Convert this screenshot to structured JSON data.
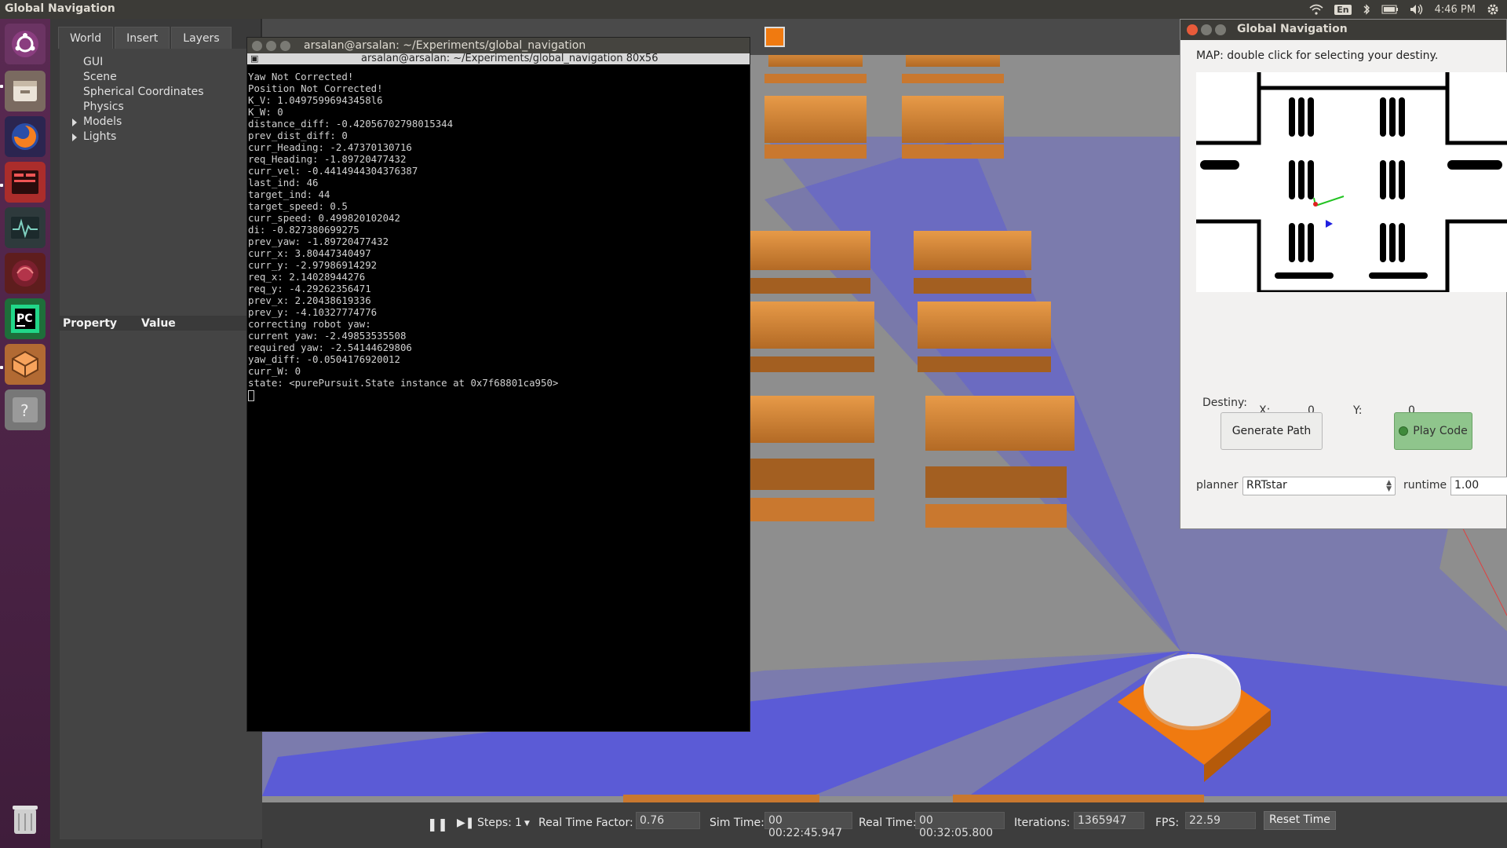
{
  "topbar": {
    "title": "Global Navigation",
    "lang": "En",
    "time": "4:46 PM"
  },
  "gazebo": {
    "tabs": [
      "World",
      "Insert",
      "Layers"
    ],
    "tree": [
      {
        "label": "GUI",
        "expandable": false
      },
      {
        "label": "Scene",
        "expandable": false
      },
      {
        "label": "Spherical Coordinates",
        "expandable": false
      },
      {
        "label": "Physics",
        "expandable": false
      },
      {
        "label": "Models",
        "expandable": true
      },
      {
        "label": "Lights",
        "expandable": true
      }
    ],
    "property_header": {
      "property": "Property",
      "value": "Value"
    },
    "bottom": {
      "steps_label": "Steps:",
      "steps_value": "1",
      "rtf_label": "Real Time Factor:",
      "rtf_value": "0.76",
      "sim_time_label": "Sim Time:",
      "sim_time_value": "00 00:22:45.947",
      "real_time_label": "Real Time:",
      "real_time_value": "00 00:32:05.800",
      "iterations_label": "Iterations:",
      "iterations_value": "1365947",
      "fps_label": "FPS:",
      "fps_value": "22.59",
      "reset_label": "Reset Time"
    }
  },
  "terminal": {
    "title": "arsalan@arsalan: ~/Experiments/global_navigation",
    "subtitle": "arsalan@arsalan: ~/Experiments/global_navigation 80x56",
    "lines": [
      "Yaw Not Corrected!",
      "Position Not Corrected!",
      "K_V: 1.04975996943458l6",
      "K_W: 0",
      "distance_diff: -0.42056702798015344",
      "prev_dist_diff: 0",
      "curr_Heading: -2.47370130716",
      "req_Heading: -1.89720477432",
      "curr_vel: -0.4414944304376387",
      "last_ind: 46",
      "target_ind: 44",
      "target_speed: 0.5",
      "curr_speed: 0.499820102042",
      "di: -0.827380699275",
      "prev_yaw: -1.89720477432",
      "curr_x: 3.80447340497",
      "curr_y: -2.97986914292",
      "req_x: 2.14028944276",
      "req_y: -4.29262356471",
      "prev_x: 2.20438619336",
      "prev_y: -4.10327774776",
      "correcting robot yaw:",
      "current yaw: -2.49853535508",
      "required yaw: -2.54144629806",
      "yaw_diff: -0.0504176920012",
      "curr_W: 0",
      "state: <purePursuit.State instance at 0x7f68801ca950>"
    ]
  },
  "nav": {
    "title": "Global Navigation",
    "hint": "MAP: double click for selecting your destiny.",
    "destiny_label": "Destiny:",
    "x_label": "X:",
    "x_value": "0",
    "y_label": "Y:",
    "y_value": "0",
    "generate_label": "Generate Path",
    "play_label": "Play Code",
    "planner_label": "planner",
    "planner_value": "RRTstar",
    "runtime_label": "runtime",
    "runtime_value": "1.00"
  },
  "colors": {
    "laser": "#3c3cff",
    "table_top": "#d8893a",
    "robot_base": "#f07a10"
  }
}
